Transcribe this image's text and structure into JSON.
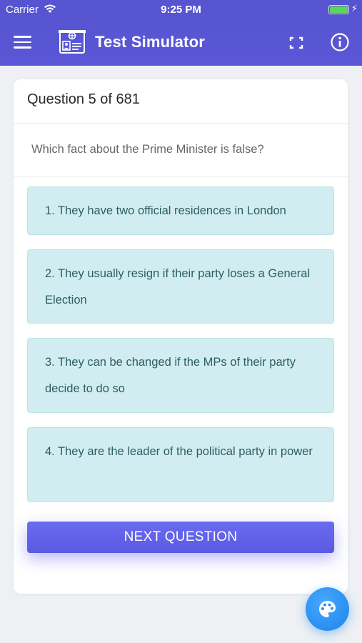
{
  "status_bar": {
    "carrier": "Carrier",
    "time": "9:25 PM"
  },
  "header": {
    "title": "Test Simulator",
    "icons": [
      "menu-icon",
      "id-card-logo-icon",
      "fullscreen-icon",
      "info-icon"
    ]
  },
  "quiz": {
    "progress_label": "Question 5 of 681",
    "question": "Which fact about the Prime Minister is false?",
    "answers": [
      {
        "label": "1. They have two official residences in London"
      },
      {
        "label": "2. They usually resign if their party loses a General Election"
      },
      {
        "label": "3. They can be changed if the MPs of their party decide to do so"
      },
      {
        "label": "4. They are the leader of the political party in power"
      }
    ],
    "next_button": "NEXT QUESTION"
  },
  "fab": {
    "icon": "palette-icon"
  },
  "colors": {
    "header": "#5654d0",
    "answer_bg": "#d2edf1",
    "answer_text": "#2c5e62",
    "button": "#6261ea",
    "fab": "#2a8ef0"
  }
}
